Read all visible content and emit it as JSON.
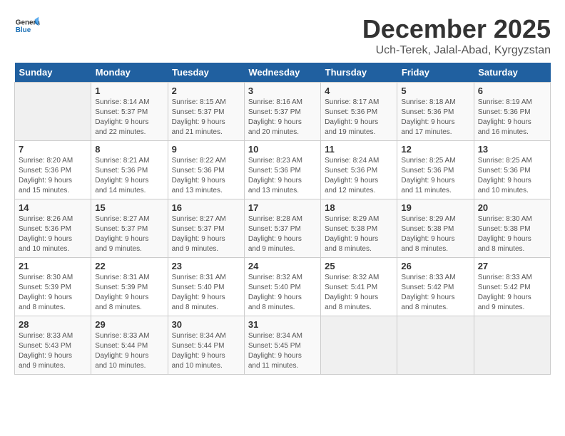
{
  "header": {
    "logo_general": "General",
    "logo_blue": "Blue",
    "month_title": "December 2025",
    "location": "Uch-Terek, Jalal-Abad, Kyrgyzstan"
  },
  "days_of_week": [
    "Sunday",
    "Monday",
    "Tuesday",
    "Wednesday",
    "Thursday",
    "Friday",
    "Saturday"
  ],
  "weeks": [
    {
      "days": [
        {
          "num": "",
          "info": ""
        },
        {
          "num": "1",
          "info": "Sunrise: 8:14 AM\nSunset: 5:37 PM\nDaylight: 9 hours\nand 22 minutes."
        },
        {
          "num": "2",
          "info": "Sunrise: 8:15 AM\nSunset: 5:37 PM\nDaylight: 9 hours\nand 21 minutes."
        },
        {
          "num": "3",
          "info": "Sunrise: 8:16 AM\nSunset: 5:37 PM\nDaylight: 9 hours\nand 20 minutes."
        },
        {
          "num": "4",
          "info": "Sunrise: 8:17 AM\nSunset: 5:36 PM\nDaylight: 9 hours\nand 19 minutes."
        },
        {
          "num": "5",
          "info": "Sunrise: 8:18 AM\nSunset: 5:36 PM\nDaylight: 9 hours\nand 17 minutes."
        },
        {
          "num": "6",
          "info": "Sunrise: 8:19 AM\nSunset: 5:36 PM\nDaylight: 9 hours\nand 16 minutes."
        }
      ]
    },
    {
      "days": [
        {
          "num": "7",
          "info": "Sunrise: 8:20 AM\nSunset: 5:36 PM\nDaylight: 9 hours\nand 15 minutes."
        },
        {
          "num": "8",
          "info": "Sunrise: 8:21 AM\nSunset: 5:36 PM\nDaylight: 9 hours\nand 14 minutes."
        },
        {
          "num": "9",
          "info": "Sunrise: 8:22 AM\nSunset: 5:36 PM\nDaylight: 9 hours\nand 13 minutes."
        },
        {
          "num": "10",
          "info": "Sunrise: 8:23 AM\nSunset: 5:36 PM\nDaylight: 9 hours\nand 13 minutes."
        },
        {
          "num": "11",
          "info": "Sunrise: 8:24 AM\nSunset: 5:36 PM\nDaylight: 9 hours\nand 12 minutes."
        },
        {
          "num": "12",
          "info": "Sunrise: 8:25 AM\nSunset: 5:36 PM\nDaylight: 9 hours\nand 11 minutes."
        },
        {
          "num": "13",
          "info": "Sunrise: 8:25 AM\nSunset: 5:36 PM\nDaylight: 9 hours\nand 10 minutes."
        }
      ]
    },
    {
      "days": [
        {
          "num": "14",
          "info": "Sunrise: 8:26 AM\nSunset: 5:36 PM\nDaylight: 9 hours\nand 10 minutes."
        },
        {
          "num": "15",
          "info": "Sunrise: 8:27 AM\nSunset: 5:37 PM\nDaylight: 9 hours\nand 9 minutes."
        },
        {
          "num": "16",
          "info": "Sunrise: 8:27 AM\nSunset: 5:37 PM\nDaylight: 9 hours\nand 9 minutes."
        },
        {
          "num": "17",
          "info": "Sunrise: 8:28 AM\nSunset: 5:37 PM\nDaylight: 9 hours\nand 9 minutes."
        },
        {
          "num": "18",
          "info": "Sunrise: 8:29 AM\nSunset: 5:38 PM\nDaylight: 9 hours\nand 8 minutes."
        },
        {
          "num": "19",
          "info": "Sunrise: 8:29 AM\nSunset: 5:38 PM\nDaylight: 9 hours\nand 8 minutes."
        },
        {
          "num": "20",
          "info": "Sunrise: 8:30 AM\nSunset: 5:38 PM\nDaylight: 9 hours\nand 8 minutes."
        }
      ]
    },
    {
      "days": [
        {
          "num": "21",
          "info": "Sunrise: 8:30 AM\nSunset: 5:39 PM\nDaylight: 9 hours\nand 8 minutes."
        },
        {
          "num": "22",
          "info": "Sunrise: 8:31 AM\nSunset: 5:39 PM\nDaylight: 9 hours\nand 8 minutes."
        },
        {
          "num": "23",
          "info": "Sunrise: 8:31 AM\nSunset: 5:40 PM\nDaylight: 9 hours\nand 8 minutes."
        },
        {
          "num": "24",
          "info": "Sunrise: 8:32 AM\nSunset: 5:40 PM\nDaylight: 9 hours\nand 8 minutes."
        },
        {
          "num": "25",
          "info": "Sunrise: 8:32 AM\nSunset: 5:41 PM\nDaylight: 9 hours\nand 8 minutes."
        },
        {
          "num": "26",
          "info": "Sunrise: 8:33 AM\nSunset: 5:42 PM\nDaylight: 9 hours\nand 8 minutes."
        },
        {
          "num": "27",
          "info": "Sunrise: 8:33 AM\nSunset: 5:42 PM\nDaylight: 9 hours\nand 9 minutes."
        }
      ]
    },
    {
      "days": [
        {
          "num": "28",
          "info": "Sunrise: 8:33 AM\nSunset: 5:43 PM\nDaylight: 9 hours\nand 9 minutes."
        },
        {
          "num": "29",
          "info": "Sunrise: 8:33 AM\nSunset: 5:44 PM\nDaylight: 9 hours\nand 10 minutes."
        },
        {
          "num": "30",
          "info": "Sunrise: 8:34 AM\nSunset: 5:44 PM\nDaylight: 9 hours\nand 10 minutes."
        },
        {
          "num": "31",
          "info": "Sunrise: 8:34 AM\nSunset: 5:45 PM\nDaylight: 9 hours\nand 11 minutes."
        },
        {
          "num": "",
          "info": ""
        },
        {
          "num": "",
          "info": ""
        },
        {
          "num": "",
          "info": ""
        }
      ]
    }
  ]
}
